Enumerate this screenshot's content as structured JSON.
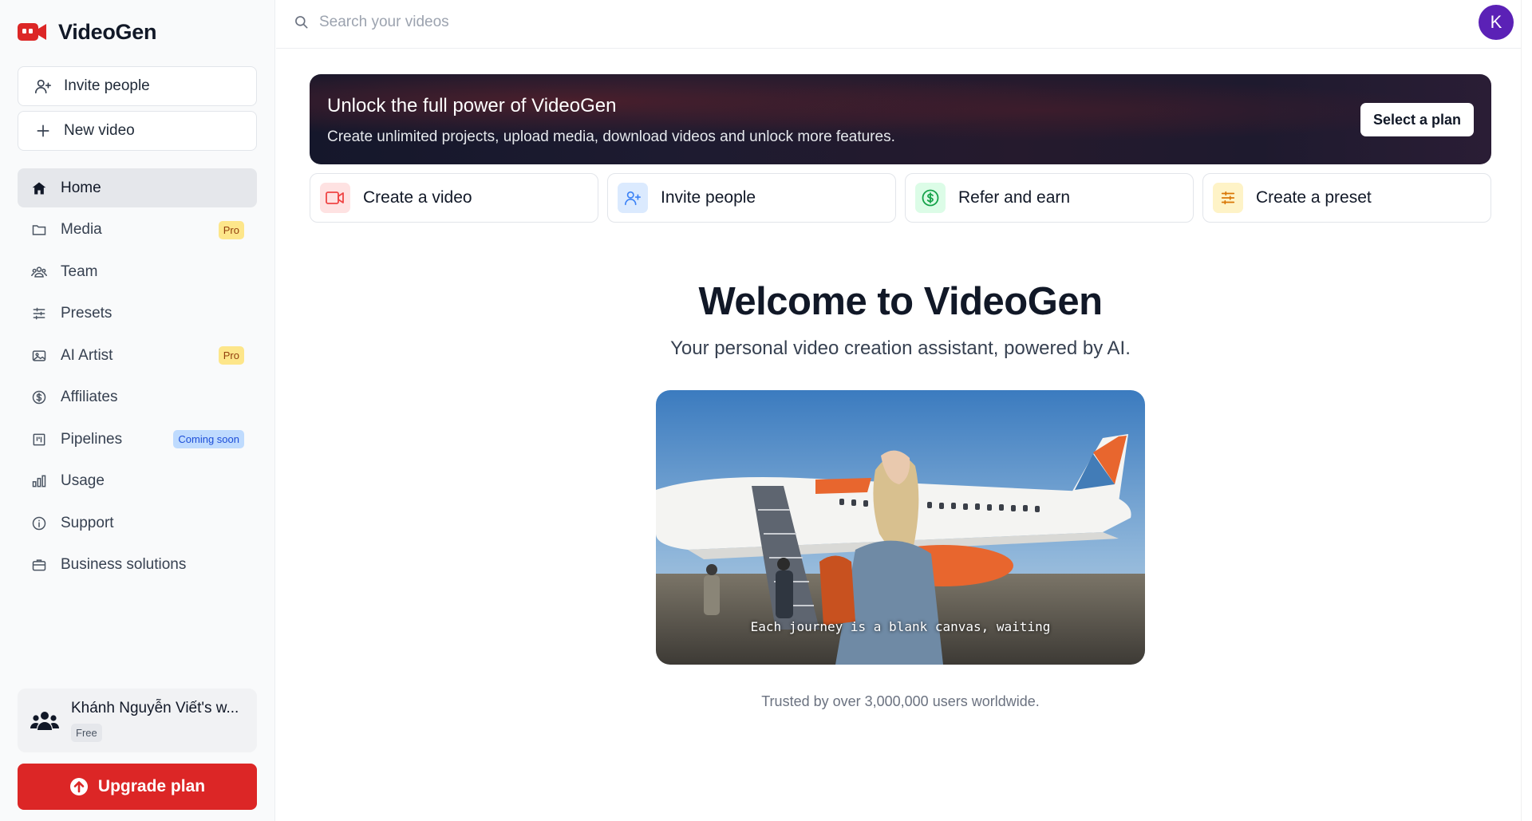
{
  "brand": {
    "name": "VideoGen",
    "accent": "#dc2626"
  },
  "sidebar": {
    "invite_label": "Invite people",
    "new_video_label": "New video",
    "nav": [
      {
        "label": "Home",
        "icon": "home-icon",
        "active": true
      },
      {
        "label": "Media",
        "icon": "folder-icon",
        "badge": "Pro"
      },
      {
        "label": "Team",
        "icon": "team-icon"
      },
      {
        "label": "Presets",
        "icon": "sliders-icon"
      },
      {
        "label": "AI Artist",
        "icon": "image-icon",
        "badge": "Pro"
      },
      {
        "label": "Affiliates",
        "icon": "dollar-icon"
      },
      {
        "label": "Pipelines",
        "icon": "kanban-icon",
        "badge": "Coming soon"
      },
      {
        "label": "Usage",
        "icon": "bar-chart-icon"
      },
      {
        "label": "Support",
        "icon": "info-icon"
      },
      {
        "label": "Business solutions",
        "icon": "briefcase-icon"
      }
    ],
    "workspace": {
      "name": "Khánh Nguyễn Viết's w...",
      "plan": "Free"
    },
    "upgrade_label": "Upgrade plan"
  },
  "topbar": {
    "search_placeholder": "Search your videos",
    "avatar_initial": "K"
  },
  "banner": {
    "title": "Unlock the full power of VideoGen",
    "subtitle": "Create unlimited projects, upload media, download videos and unlock more features.",
    "button": "Select a plan"
  },
  "quick_actions": [
    {
      "label": "Create a video",
      "icon": "video-camera-icon",
      "color": "#ef4444"
    },
    {
      "label": "Invite people",
      "icon": "user-plus-icon",
      "color": "#3b82f6"
    },
    {
      "label": "Refer and earn",
      "icon": "dollar-circle-icon",
      "color": "#16a34a"
    },
    {
      "label": "Create a preset",
      "icon": "sliders-icon",
      "color": "#d97706"
    }
  ],
  "welcome": {
    "title": "Welcome to VideoGen",
    "subtitle": "Your personal video creation assistant, powered by AI.",
    "video_caption": "Each journey is a blank canvas, waiting",
    "trusted": "Trusted by over 3,000,000 users worldwide."
  }
}
